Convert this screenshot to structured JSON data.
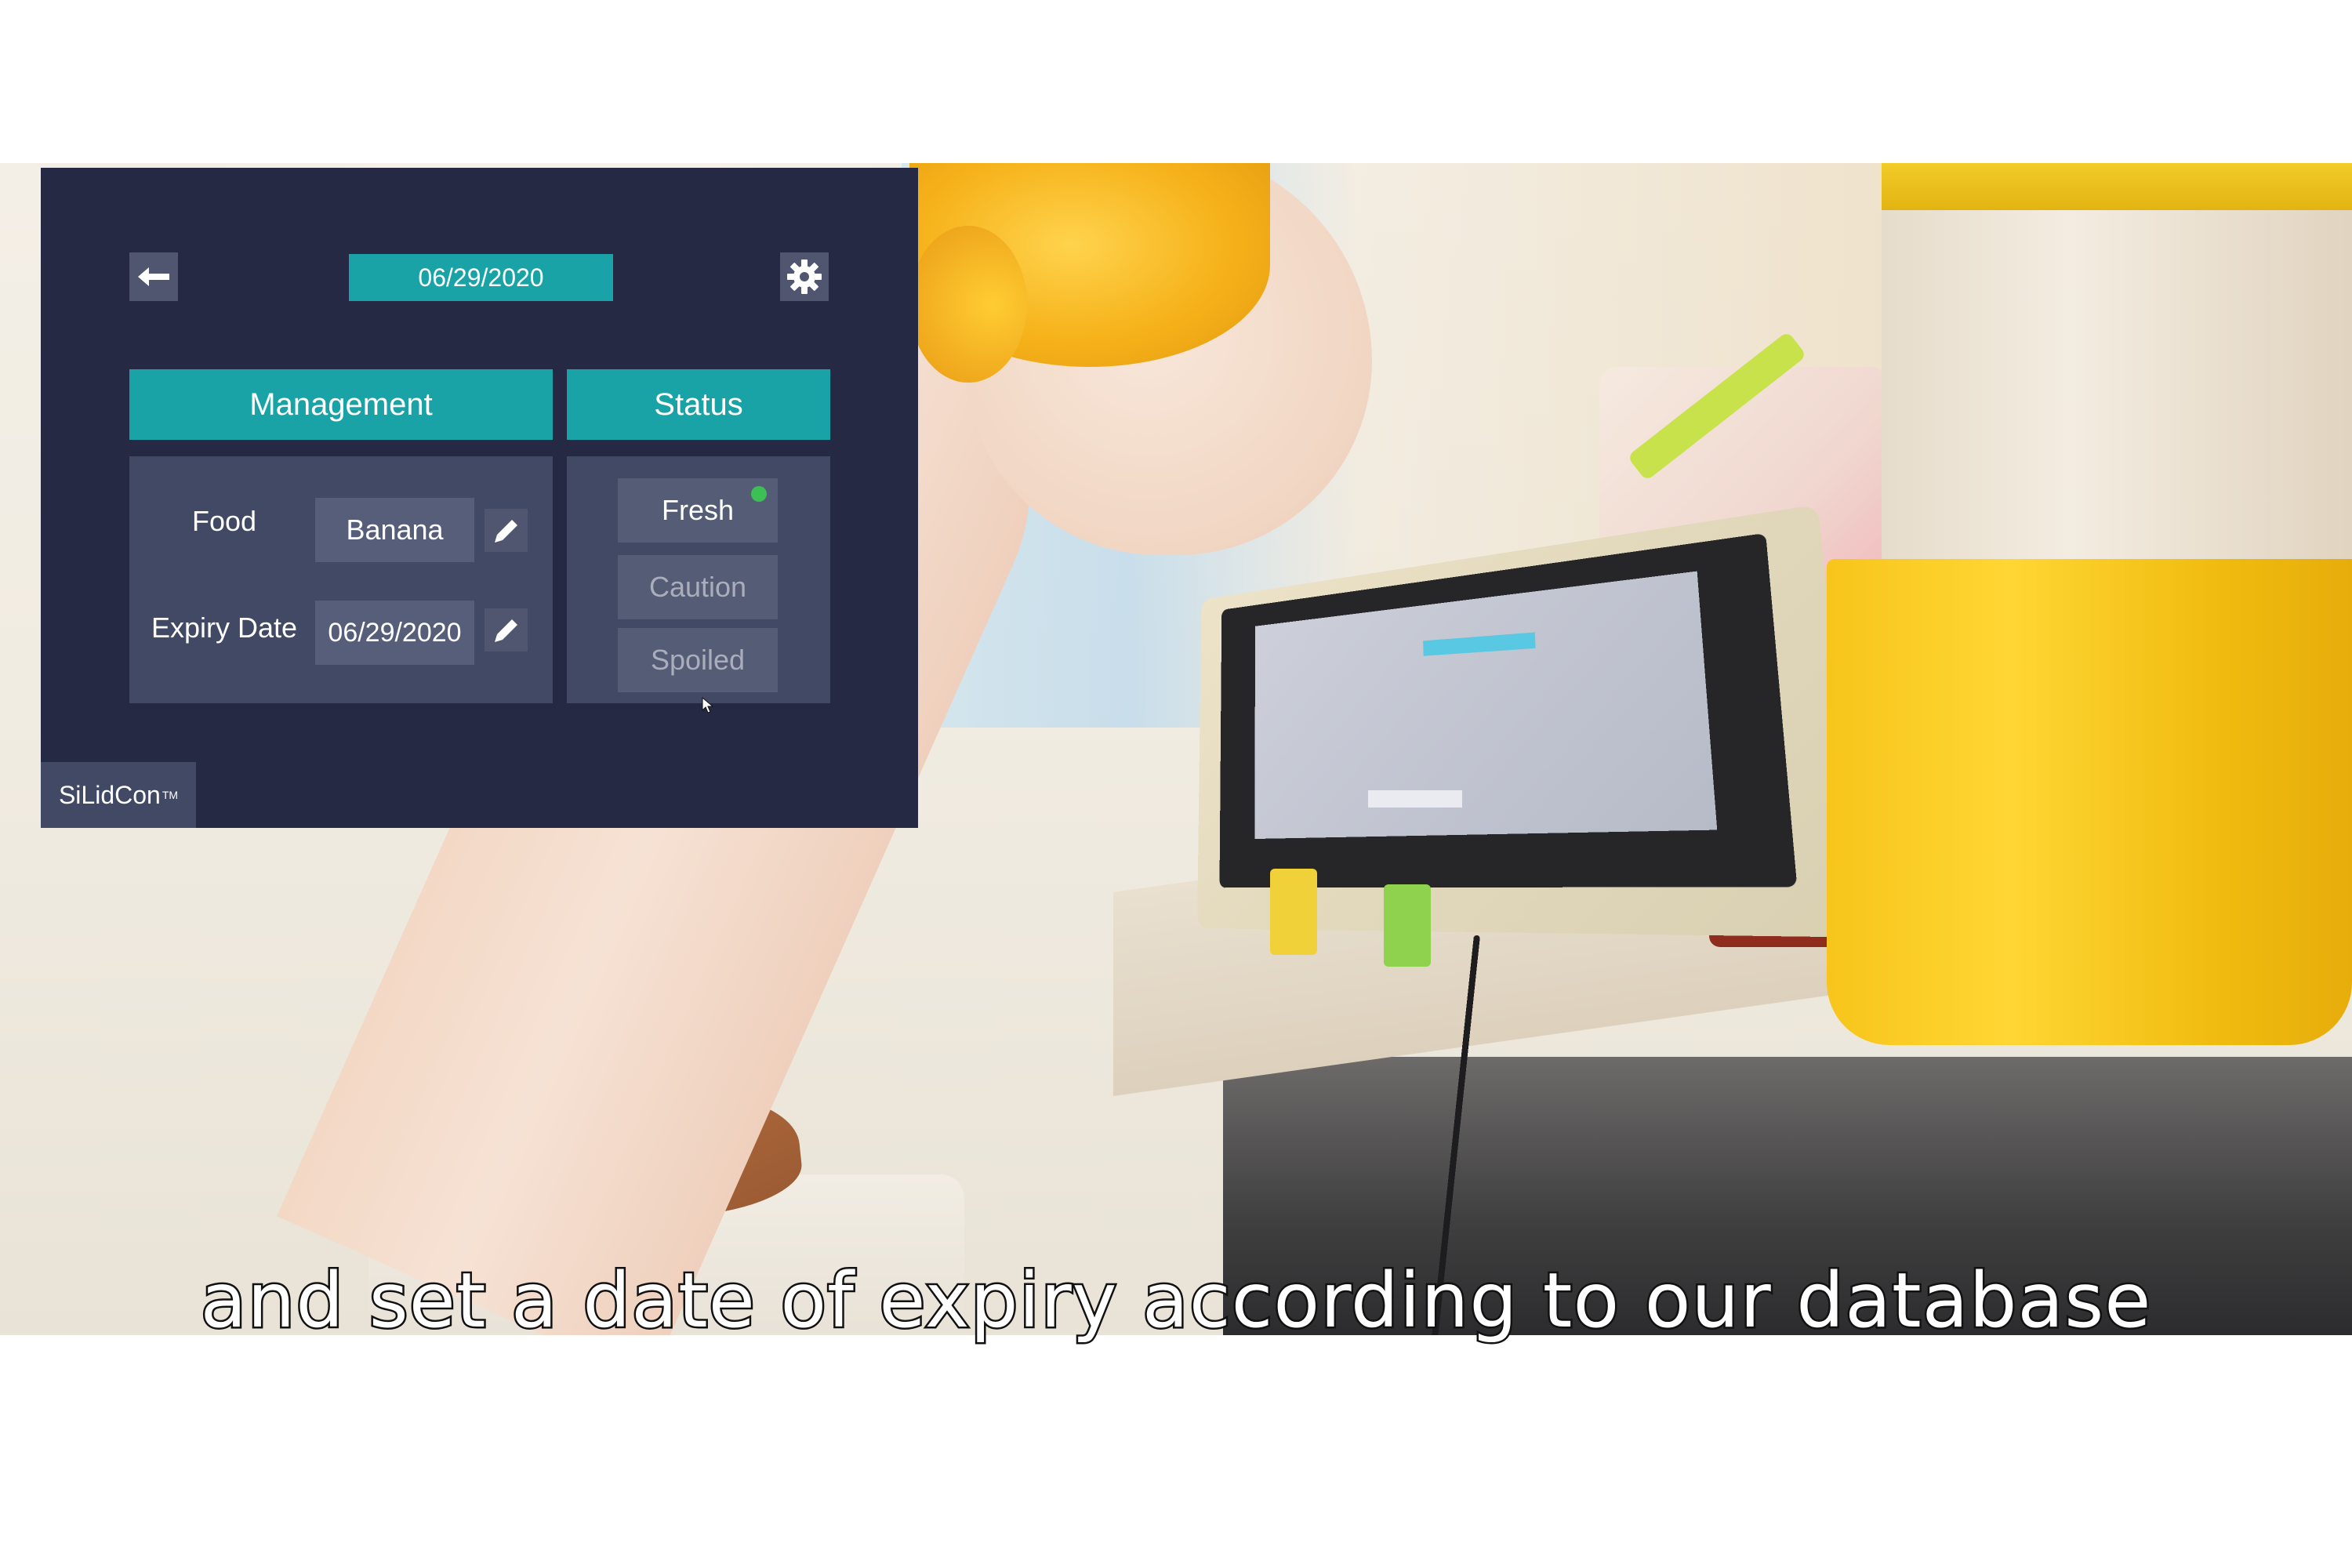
{
  "app": {
    "date_header": "06/29/2020",
    "tabs": [
      {
        "label": "Management"
      },
      {
        "label": "Status"
      }
    ],
    "fields": {
      "food": {
        "label": "Food",
        "value": "Banana"
      },
      "expiry": {
        "label": "Expiry Date",
        "value": "06/29/2020"
      }
    },
    "statuses": [
      {
        "label": "Fresh",
        "active": true,
        "indicator_color": "#3cbf55"
      },
      {
        "label": "Caution",
        "active": false
      },
      {
        "label": "Spoiled",
        "active": false
      }
    ],
    "brand": {
      "name": "SiLidCon",
      "mark": "TM"
    },
    "icons": [
      "back-arrow-icon",
      "gear-icon",
      "pencil-icon",
      "cursor-icon"
    ]
  },
  "subtitle": "and set a date of expiry according to our database",
  "colors": {
    "panel_bg": "#252944",
    "accent_teal": "#1aa3a7",
    "card_bg": "#424965",
    "button_bg": "#555c76",
    "fresh_indicator": "#3cbf55"
  }
}
